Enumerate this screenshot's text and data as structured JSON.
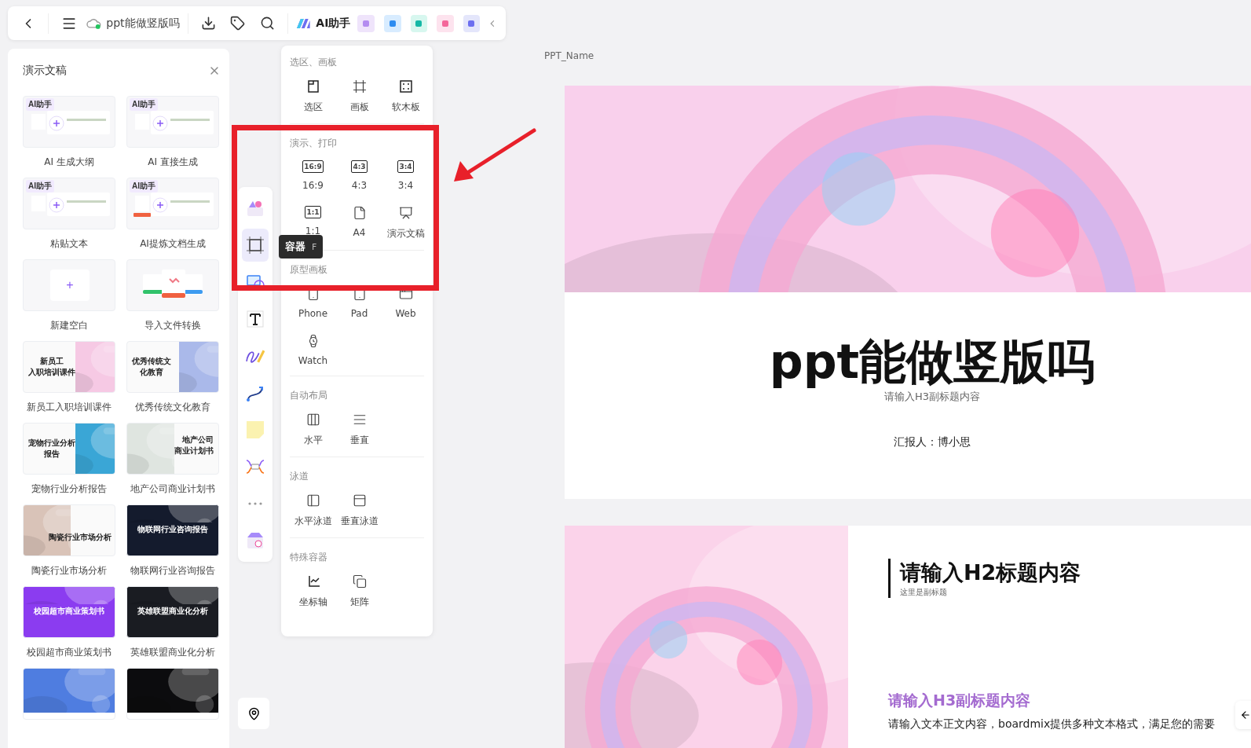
{
  "toolbar": {
    "title": "ppt能做竖版吗",
    "ai_label": "AI助手"
  },
  "panel": {
    "title": "演示文稿",
    "cards": [
      {
        "kind": "ai",
        "label": "AI 生成大纲",
        "badge": "AI助手"
      },
      {
        "kind": "ai",
        "label": "AI 直接生成",
        "badge": "AI助手"
      },
      {
        "kind": "ai",
        "label": "粘贴文本",
        "badge": "AI助手"
      },
      {
        "kind": "ai",
        "label": "AI提炼文档生成",
        "badge": "AI助手"
      },
      {
        "kind": "blank",
        "label": "新建空白",
        "symbol": "+"
      },
      {
        "kind": "import",
        "label": "导入文件转换"
      },
      {
        "kind": "template",
        "label": "新员工入职培训课件",
        "lines": [
          "新员工",
          "入职培训课件"
        ],
        "color": "#f6c9e4",
        "dark": false
      },
      {
        "kind": "template",
        "label": "优秀传统文化教育",
        "lines": [
          "优秀传统文",
          "化教育"
        ],
        "color": "#aab9ea",
        "dark": false
      },
      {
        "kind": "template",
        "label": "宠物行业分析报告",
        "lines": [
          "宠物行业分析",
          "报告"
        ],
        "color": "#3aa6d6",
        "dark": false
      },
      {
        "kind": "template",
        "label": "地产公司商业计划书",
        "lines": [
          "地产公司",
          "商业计划书"
        ],
        "color": "#dfe5e0",
        "dark": false
      },
      {
        "kind": "template",
        "label": "陶瓷行业市场分析",
        "lines": [
          "陶瓷行业市场分析"
        ],
        "color": "#d9c3b8",
        "dark": false
      },
      {
        "kind": "template",
        "label": "物联网行业咨询报告",
        "lines": [
          "物联网行业咨询报告"
        ],
        "color": "#141b2d",
        "dark": true
      },
      {
        "kind": "template",
        "label": "校园超市商业策划书",
        "lines": [
          "校园超市商业策划书"
        ],
        "color": "#8b3cf0",
        "dark": true
      },
      {
        "kind": "template",
        "label": "英雄联盟商业化分析",
        "lines": [
          "英雄联盟商业化分析"
        ],
        "color": "#1a1c22",
        "dark": true
      },
      {
        "kind": "cover",
        "color": "#4f7de0"
      },
      {
        "kind": "cover",
        "color": "#0c0c0e"
      }
    ]
  },
  "tool_strip": {
    "items": [
      {
        "kind": "templates",
        "selected": false
      },
      {
        "kind": "container",
        "selected": true
      },
      {
        "kind": "shape",
        "selected": false
      },
      {
        "kind": "text",
        "selected": false
      },
      {
        "kind": "pen",
        "selected": false
      },
      {
        "kind": "connector",
        "selected": false
      },
      {
        "kind": "sticky",
        "selected": false
      },
      {
        "kind": "mindmap",
        "selected": false
      },
      {
        "kind": "more",
        "selected": false
      },
      {
        "kind": "plugin",
        "selected": false
      }
    ],
    "tooltip": {
      "label": "容器",
      "shortcut": "F"
    }
  },
  "menu": {
    "sections": [
      {
        "title": "选区、画板",
        "items": [
          {
            "kind": "selection",
            "label": "选区"
          },
          {
            "kind": "frame",
            "label": "画板"
          },
          {
            "kind": "cork",
            "label": "软木板"
          }
        ]
      },
      {
        "title": "演示、打印",
        "items": [
          {
            "kind": "ratio",
            "icon_text": "16:9",
            "label": "16:9"
          },
          {
            "kind": "ratio",
            "icon_text": "4:3",
            "label": "4:3"
          },
          {
            "kind": "ratio",
            "icon_text": "3:4",
            "label": "3:4"
          },
          {
            "kind": "ratio",
            "icon_text": "1:1",
            "label": "1:1"
          },
          {
            "kind": "page",
            "label": "A4"
          },
          {
            "kind": "presentation",
            "label": "演示文稿"
          }
        ]
      },
      {
        "title": "原型画板",
        "items": [
          {
            "kind": "phone",
            "label": "Phone"
          },
          {
            "kind": "pad",
            "label": "Pad"
          },
          {
            "kind": "web",
            "label": "Web"
          },
          {
            "kind": "watch",
            "label": "Watch"
          }
        ]
      },
      {
        "title": "自动布局",
        "items": [
          {
            "kind": "columns",
            "label": "水平"
          },
          {
            "kind": "rows",
            "label": "垂直"
          }
        ]
      },
      {
        "title": "泳道",
        "items": [
          {
            "kind": "lane-h",
            "label": "水平泳道"
          },
          {
            "kind": "lane-v",
            "label": "垂直泳道"
          }
        ]
      },
      {
        "title": "特殊容器",
        "items": [
          {
            "kind": "axis",
            "label": "坐标轴"
          },
          {
            "kind": "matrix",
            "label": "矩阵"
          }
        ]
      }
    ]
  },
  "canvas": {
    "page_name": "PPT_Name",
    "cover_slide": {
      "title": "ppt能做竖版吗",
      "subtitle": "请输入H3副标题内容",
      "reporter": "汇报人：博小思"
    },
    "content_slide": {
      "heading": "请输入H2标题内容",
      "subheading": "这里是副标题",
      "h3": "请输入H3副标题内容",
      "body": "请输入文本正文内容，boardmix提供多种文本格式，满足您的需要"
    }
  },
  "annotation": {
    "box": true,
    "arrow": true
  }
}
